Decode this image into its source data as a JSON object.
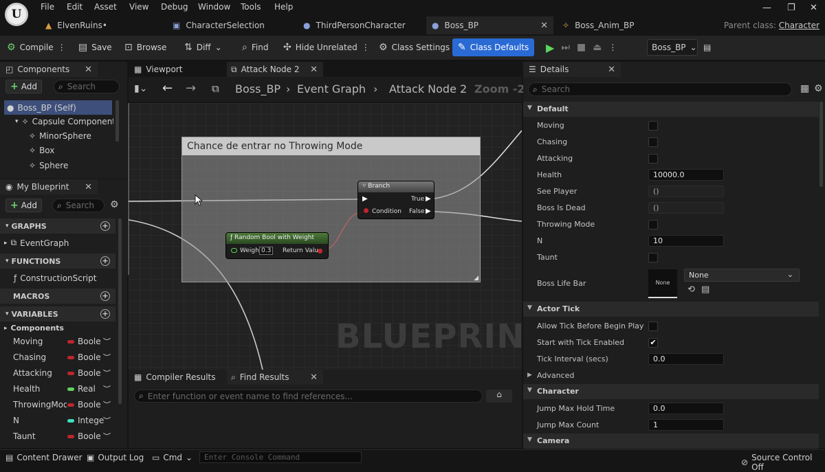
{
  "menu": [
    "File",
    "Edit",
    "Asset",
    "View",
    "Debug",
    "Window",
    "Tools",
    "Help"
  ],
  "tabs": [
    {
      "label": "ElvenRuins•"
    },
    {
      "label": "CharacterSelection"
    },
    {
      "label": "ThirdPersonCharacter"
    },
    {
      "label": "Boss_BP"
    },
    {
      "label": "Boss_Anim_BP"
    }
  ],
  "parent_class": {
    "prefix": "Parent class:",
    "value": "Character"
  },
  "toolbar": {
    "compile": "Compile",
    "save": "Save",
    "browse": "Browse",
    "diff": "Diff",
    "find": "Find",
    "hide_unrelated": "Hide Unrelated",
    "class_settings": "Class Settings",
    "class_defaults": "Class Defaults",
    "debug_object": "Boss_BP"
  },
  "components_panel": {
    "title": "Components",
    "add": "Add",
    "search_placeholder": "Search",
    "items": [
      "Boss_BP (Self)",
      "Capsule Component (C",
      "MinorSphere",
      "Box",
      "Sphere"
    ]
  },
  "my_blueprint": {
    "title": "My Blueprint",
    "add": "Add",
    "search_placeholder": "Search",
    "graphs_label": "GRAPHS",
    "event_graph": "EventGraph",
    "functions_label": "FUNCTIONS",
    "construction_script": "ConstructionScript",
    "macros_label": "MACROS",
    "variables_label": "VARIABLES",
    "components_label": "Components",
    "variables": [
      {
        "name": "Moving",
        "type": "Boole",
        "color": "#c0262d"
      },
      {
        "name": "Chasing",
        "type": "Boole",
        "color": "#c0262d"
      },
      {
        "name": "Attacking",
        "type": "Boole",
        "color": "#c0262d"
      },
      {
        "name": "Health",
        "type": "Real",
        "color": "#5fd35f"
      },
      {
        "name": "ThrowingMode",
        "type": "Boole",
        "color": "#c0262d"
      },
      {
        "name": "N",
        "type": "Intege",
        "color": "#3ee0c0"
      },
      {
        "name": "Taunt",
        "type": "Boole",
        "color": "#c0262d"
      }
    ]
  },
  "editor_tabs": {
    "viewport": "Viewport",
    "attack_node": "Attack Node 2"
  },
  "breadcrumb": {
    "bp": "Boss_BP",
    "graph": "Event Graph",
    "node": "Attack Node 2",
    "zoom": "Zoom -2"
  },
  "graph": {
    "comment": "Chance de entrar no Throwing Mode",
    "branch": {
      "title": "Branch",
      "true": "True",
      "condition": "Condition",
      "false": "False"
    },
    "random_bool": {
      "title": "Random Bool with Weight",
      "weight": "Weight",
      "weight_value": "0.3",
      "return": "Return Value"
    },
    "watermark": "BLUEPRINT"
  },
  "bottom_tabs": {
    "compiler": "Compiler Results",
    "find": "Find Results",
    "find_placeholder": "Enter function or event name to find references..."
  },
  "details": {
    "title": "Details",
    "search_placeholder": "Search",
    "sec_default": "Default",
    "moving": "Moving",
    "chasing": "Chasing",
    "attacking": "Attacking",
    "health": "Health",
    "health_value": "10000.0",
    "see_player": "See Player",
    "see_player_value": "()",
    "boss_is_dead": "Boss Is Dead",
    "boss_is_dead_value": "()",
    "throwing_mode": "Throwing Mode",
    "n": "N",
    "n_value": "10",
    "taunt": "Taunt",
    "boss_life_bar": "Boss Life Bar",
    "life_bar_thumb": "None",
    "life_bar_select": "None",
    "sec_actor_tick": "Actor Tick",
    "allow_tick": "Allow Tick Before Begin Play",
    "start_tick": "Start with Tick Enabled",
    "tick_interval": "Tick Interval (secs)",
    "tick_interval_value": "0.0",
    "advanced": "Advanced",
    "sec_character": "Character",
    "jump_hold": "Jump Max Hold Time",
    "jump_hold_value": "0.0",
    "jump_count": "Jump Max Count",
    "jump_count_value": "1",
    "sec_camera": "Camera"
  },
  "statusbar": {
    "content_drawer": "Content Drawer",
    "output_log": "Output Log",
    "cmd": "Cmd",
    "console_placeholder": "Enter Console Command",
    "source_control": "Source Control Off"
  }
}
